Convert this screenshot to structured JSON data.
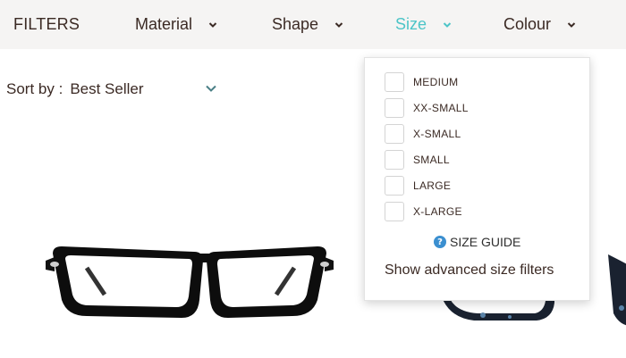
{
  "filters": {
    "title": "FILTERS",
    "items": [
      {
        "label": "Material",
        "icon": "chevron-down-icon",
        "active": false
      },
      {
        "label": "Shape",
        "icon": "chevron-down-icon",
        "active": false
      },
      {
        "label": "Size",
        "icon": "chevron-down-icon",
        "active": true
      },
      {
        "label": "Colour",
        "icon": "chevron-down-icon",
        "active": false
      }
    ],
    "active_color": "#4cc4c7",
    "bar_color": "#f5f4f3"
  },
  "sort": {
    "label": "Sort by :",
    "value": "Best Seller",
    "icon": "chevron-down-icon"
  },
  "size_dropdown": {
    "options": [
      {
        "label": "MEDIUM",
        "checked": false
      },
      {
        "label": "XX-SMALL",
        "checked": false
      },
      {
        "label": "X-SMALL",
        "checked": false
      },
      {
        "label": "SMALL",
        "checked": false
      },
      {
        "label": "LARGE",
        "checked": false
      },
      {
        "label": "X-LARGE",
        "checked": false
      }
    ],
    "size_guide_label": "SIZE GUIDE",
    "size_guide_icon": "question-circle-icon",
    "advanced_label": "Show advanced size filters"
  },
  "products": [
    {
      "image": "black-rectangular-glasses-image"
    },
    {
      "image": "tortoise-glasses-image"
    }
  ]
}
